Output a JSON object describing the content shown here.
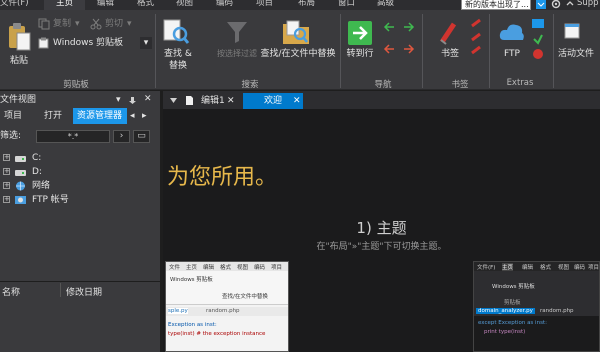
{
  "menubar": {
    "items": [
      "文件(F)",
      "主页",
      "编辑",
      "格式",
      "视图",
      "编码",
      "项目",
      "布局",
      "窗口",
      "高级"
    ],
    "active_index": 1,
    "update_notice": "新的版本出现了...",
    "help_label": "Supp"
  },
  "ribbon": {
    "clipboard": {
      "paste_label": "粘贴",
      "copy_label": "复制",
      "cut_label": "剪切",
      "clipboard_select_value": "Windows 剪贴板",
      "group_label": "剪贴板"
    },
    "search": {
      "find_replace_label_1": "查找 &",
      "find_replace_label_2": "替换",
      "filter_label": "按选择过滤",
      "find_in_files_label": "查找/在文件中替换",
      "group_label": "搜索"
    },
    "navigation": {
      "goto_label": "转到行",
      "group_label": "导航"
    },
    "bookmarks": {
      "bookmark_label": "书签",
      "group_label": "书签"
    },
    "extras": {
      "ftp_label": "FTP",
      "group_label": "Extras"
    },
    "active_files_label": "活动文件"
  },
  "file_panel": {
    "title": "文件视图",
    "pin_symbol": "▾ 📌",
    "close_symbol": "✕",
    "tabs": [
      "项目",
      "打开",
      "资源管理器"
    ],
    "active_tab_index": 2,
    "filter_label": "筛选:",
    "filter_value": "*.*",
    "tree": [
      {
        "label": "C:",
        "icon": "drive-icon"
      },
      {
        "label": "D:",
        "icon": "drive-icon"
      },
      {
        "label": "网络",
        "icon": "network-icon"
      },
      {
        "label": "FTP 帐号",
        "icon": "ftp-icon"
      }
    ],
    "columns": [
      "名称",
      "修改日期"
    ]
  },
  "editor": {
    "tabs": [
      {
        "label": "编辑1",
        "active": false
      },
      {
        "label": "欢迎",
        "active": true
      }
    ],
    "hero_text": "为您所用。",
    "topic_title": "1) 主题",
    "topic_subtitle": "在\"布局\"»\"主题\"下可切换主题。",
    "thumb_light": {
      "menu": [
        "文件",
        "主页",
        "编辑",
        "格式",
        "视图",
        "编码",
        "项目"
      ],
      "tabs": [
        "sple.py",
        "random.php"
      ],
      "code_1": "Exception as inst:",
      "code_2": "type(inst)    # the exception instance",
      "ribbon_label": "查找/在文件中替换",
      "clipboard_value": "Windows 剪贴板"
    },
    "thumb_dark": {
      "menu": [
        "文件(F)",
        "主页",
        "编辑",
        "格式",
        "视图",
        "编码",
        "项目"
      ],
      "tabs": [
        "domain_analyzer.py",
        "random.php"
      ],
      "code_1": "except Exception as inst:",
      "code_2": "print type(inst)",
      "clipboard_value": "Windows 剪贴板",
      "group_label": "剪贴板"
    }
  },
  "colors": {
    "accent": "#007acc",
    "hero": "#e7b84b"
  }
}
